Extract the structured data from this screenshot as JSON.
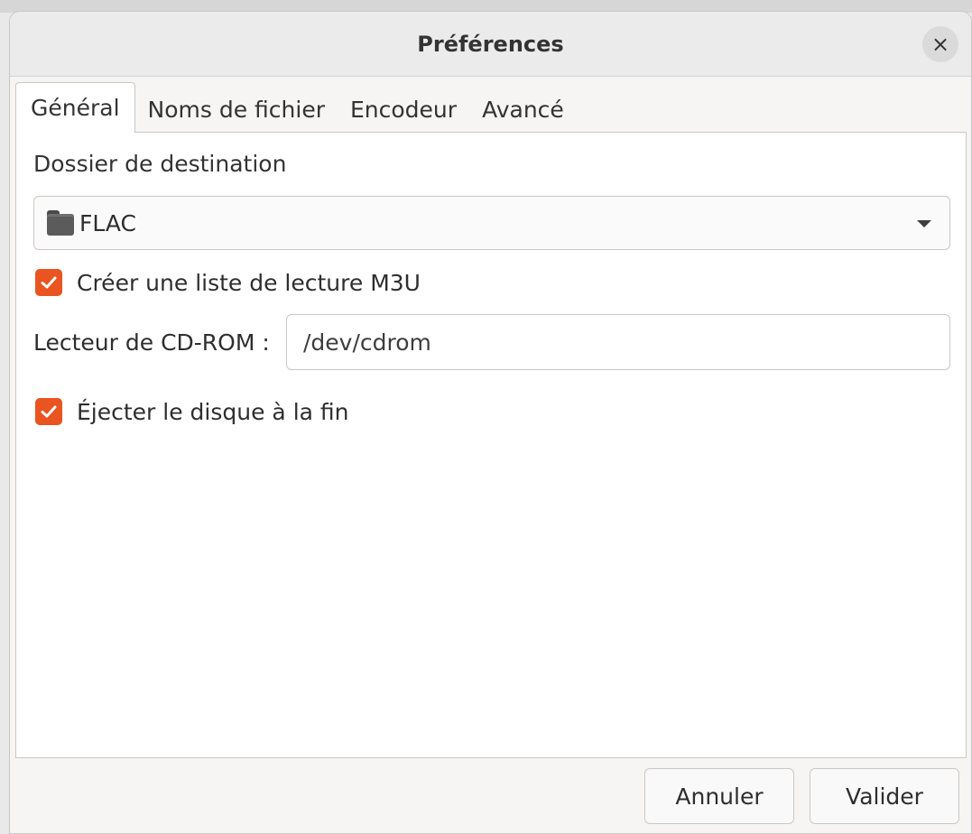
{
  "window": {
    "title": "Préférences",
    "close_icon": "×"
  },
  "tabs": [
    {
      "label": "Général",
      "active": true
    },
    {
      "label": "Noms de fichier",
      "active": false
    },
    {
      "label": "Encodeur",
      "active": false
    },
    {
      "label": "Avancé",
      "active": false
    }
  ],
  "general": {
    "destination_label": "Dossier de destination",
    "destination_value": "FLAC",
    "destination_icon": "folder-icon",
    "create_playlist": {
      "label": "Créer une liste de lecture M3U",
      "checked": true
    },
    "cdrom_label": "Lecteur de CD-ROM :",
    "cdrom_value": "/dev/cdrom",
    "eject": {
      "label": "Éjecter le disque à la fin",
      "checked": true
    }
  },
  "buttons": {
    "cancel": "Annuler",
    "ok": "Valider"
  },
  "colors": {
    "accent": "#e95420",
    "titlebar": "#ebebeb",
    "panel": "#ffffff"
  }
}
